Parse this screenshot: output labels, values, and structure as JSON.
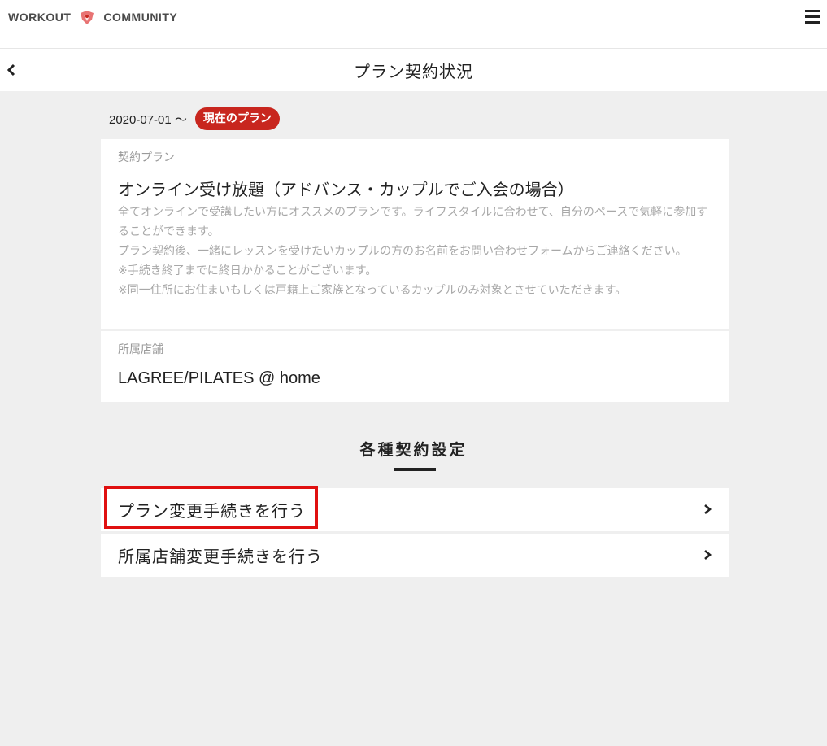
{
  "header": {
    "logo_left": "WORKOUT",
    "logo_right": "COMMUNITY",
    "menu_icon": "hamburger-menu-icon"
  },
  "subheader": {
    "title": "プラン契約状況",
    "back_icon": "chevron-left-icon"
  },
  "contract": {
    "start_date": "2020-07-01 〜",
    "badge": "現在のプラン",
    "plan_label": "契約プラン",
    "plan_name": "オンライン受け放題（アドバンス・カップルでご入会の場合）",
    "plan_description": [
      "全てオンラインで受講したい方にオススメのプランです。ライフスタイルに合わせて、自分のペースで気軽に参加することができます。",
      "プラン契約後、一緒にレッスンを受けたいカップルの方のお名前をお問い合わせフォームからご連絡ください。",
      "※手続き終了までに終日かかることがございます。",
      "※同一住所にお住まいもしくは戸籍上ご家族となっているカップルのみ対象とさせていただきます。"
    ],
    "store_label": "所属店舗",
    "store_name": "LAGREE/PILATES @ home"
  },
  "settings": {
    "title": "各種契約設定",
    "items": [
      {
        "label": "プラン変更手続きを行う",
        "icon": "chevron-right-icon"
      },
      {
        "label": "所属店舗変更手続きを行う",
        "icon": "chevron-right-icon"
      }
    ]
  },
  "colors": {
    "badge": "#c8261e",
    "highlight": "#e01010",
    "background": "#efefef"
  }
}
